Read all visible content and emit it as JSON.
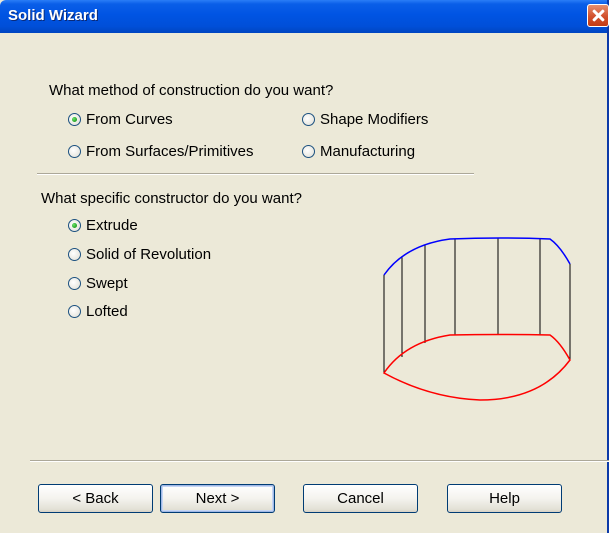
{
  "window": {
    "title": "Solid Wizard"
  },
  "method_section": {
    "question": "What method of construction do you want?",
    "options": [
      {
        "label": "From Curves",
        "checked": true
      },
      {
        "label": "Shape Modifiers",
        "checked": false
      },
      {
        "label": "From Surfaces/Primitives",
        "checked": false
      },
      {
        "label": "Manufacturing",
        "checked": false
      }
    ]
  },
  "constructor_section": {
    "question": "What specific constructor do you want?",
    "options": [
      {
        "label": "Extrude",
        "checked": true
      },
      {
        "label": "Solid of Revolution",
        "checked": false
      },
      {
        "label": "Swept",
        "checked": false
      },
      {
        "label": "Lofted",
        "checked": false
      }
    ]
  },
  "preview": {
    "top_curve_color": "#0000ff",
    "bottom_curve_color": "#ff0000",
    "rule_color": "#000000"
  },
  "buttons": {
    "back": "< Back",
    "next": "Next >",
    "cancel": "Cancel",
    "help": "Help"
  }
}
